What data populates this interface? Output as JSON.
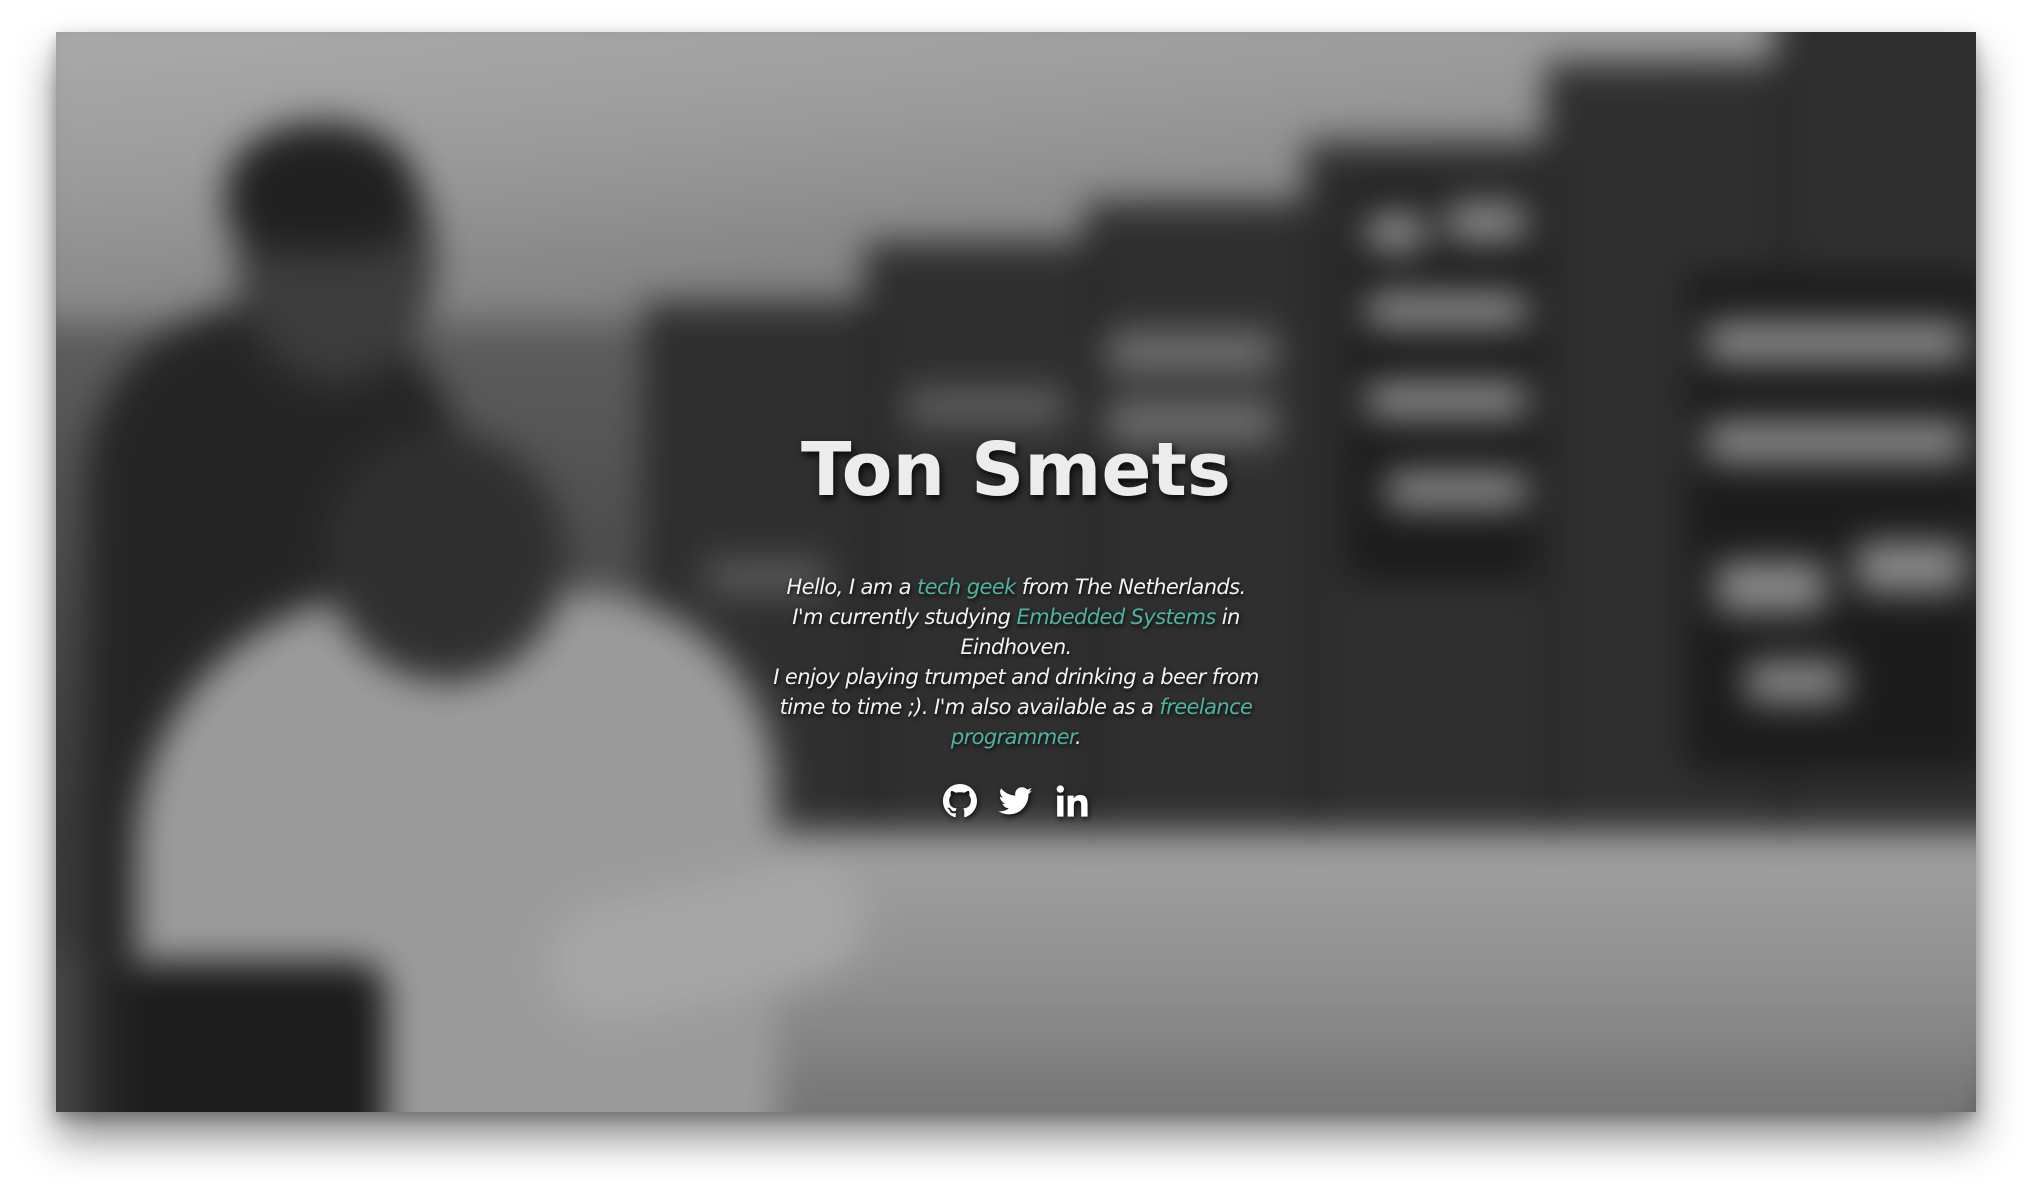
{
  "profile": {
    "name": "Ton Smets",
    "bio": {
      "line1_pre": "Hello, I am a ",
      "line1_link": "tech geek",
      "line1_post": " from The Netherlands.",
      "line2_pre": "I'm currently studying ",
      "line2_link": "Embedded Systems",
      "line2_post": " in Eindhoven.",
      "line3_pre": "I enjoy playing trumpet and drinking a beer from time to time ;). I'm also available as a ",
      "line3_link": "freelance programmer",
      "line3_post": "."
    }
  },
  "social": {
    "items": [
      {
        "icon": "github-icon"
      },
      {
        "icon": "twitter-icon"
      },
      {
        "icon": "linkedin-icon"
      }
    ]
  },
  "colors": {
    "accent": "#4fb3a1",
    "text": "#ffffff"
  }
}
